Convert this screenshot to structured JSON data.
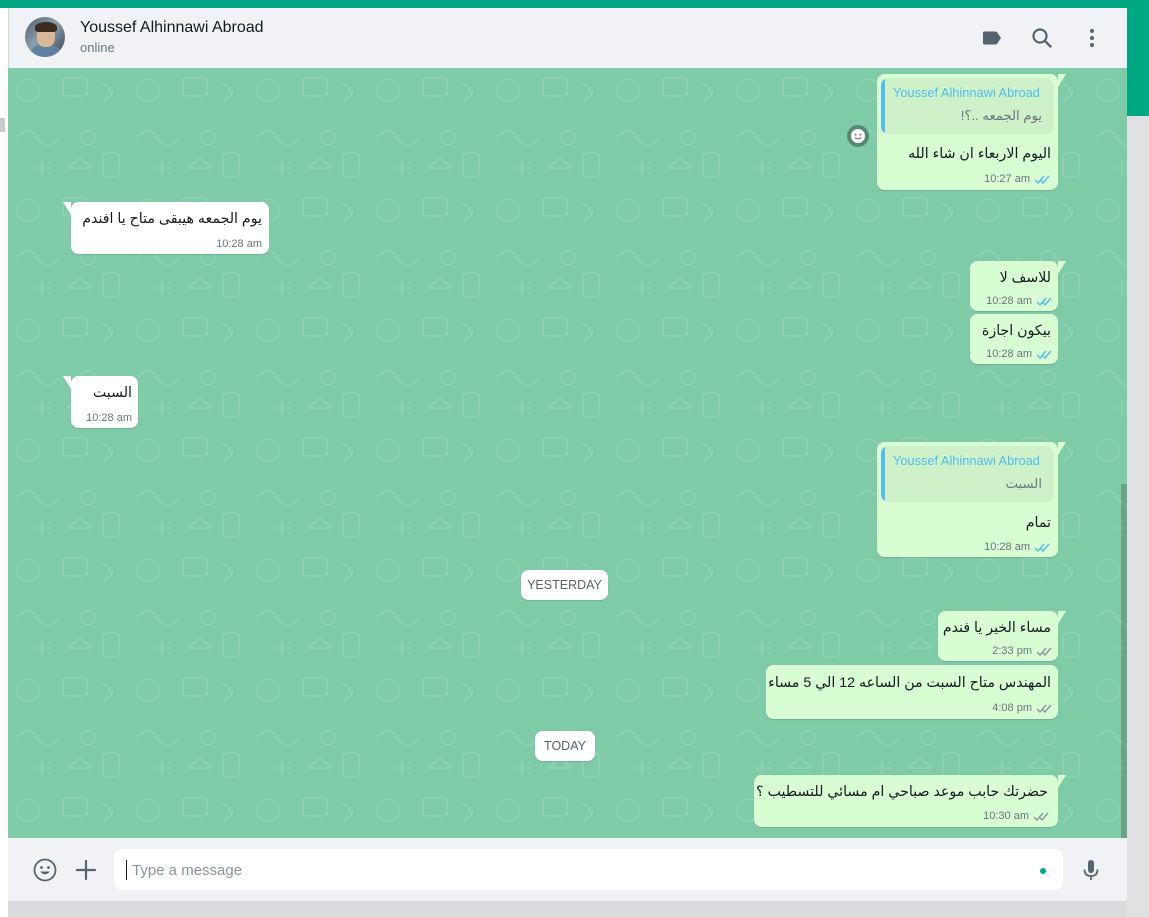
{
  "header": {
    "contact_name": "Youssef Alhinnawi Abroad",
    "contact_status": "online",
    "icons": [
      "label-icon",
      "search-icon",
      "menu-icon"
    ]
  },
  "messages": [
    {
      "direction": "out",
      "quote": {
        "author": "Youssef Alhinnawi Abroad",
        "text": "يوم الجمعه ..؟!"
      },
      "text": "اليوم الاربعاء ان شاء الله",
      "time": "10:27 am",
      "status": "read"
    },
    {
      "direction": "in",
      "text": "يوم الجمعه هيبقى متاح يا افندم",
      "time": "10:28 am"
    },
    {
      "direction": "out",
      "text": "للاسف لا",
      "time": "10:28 am",
      "status": "read"
    },
    {
      "direction": "out",
      "text": "بيكون اجازة",
      "time": "10:28 am",
      "status": "read"
    },
    {
      "direction": "in",
      "text": "السبت",
      "time": "10:28 am"
    },
    {
      "direction": "out",
      "quote": {
        "author": "Youssef Alhinnawi Abroad",
        "text": "السبت"
      },
      "text": "تمام",
      "time": "10:28 am",
      "status": "read"
    },
    {
      "direction": "out",
      "text": "مساء الخير يا فندم",
      "time": "2:33 pm",
      "status": "delivered"
    },
    {
      "direction": "out",
      "text": "المهندس متاح السبت من الساعه 12 الي 5 مساء",
      "time": "4:08 pm",
      "status": "delivered"
    },
    {
      "direction": "out",
      "text": "حضرتك حابب موعد صباحي ام مسائي للتسطيب ؟",
      "time": "10:30 am",
      "status": "delivered"
    }
  ],
  "date_separators": {
    "yesterday": "YESTERDAY",
    "today": "TODAY"
  },
  "footer": {
    "input_placeholder": "Type a message",
    "input_value": "",
    "icons": [
      "emoji-icon",
      "attach-plus-icon",
      "microphone-icon"
    ]
  },
  "colors": {
    "accent": "#00a884",
    "chat_background": "#7fcaa7",
    "outgoing_bubble": "#d9fdd3",
    "incoming_bubble": "#ffffff",
    "read_ticks": "#53bdeb",
    "delivered_ticks": "#8696a0"
  }
}
